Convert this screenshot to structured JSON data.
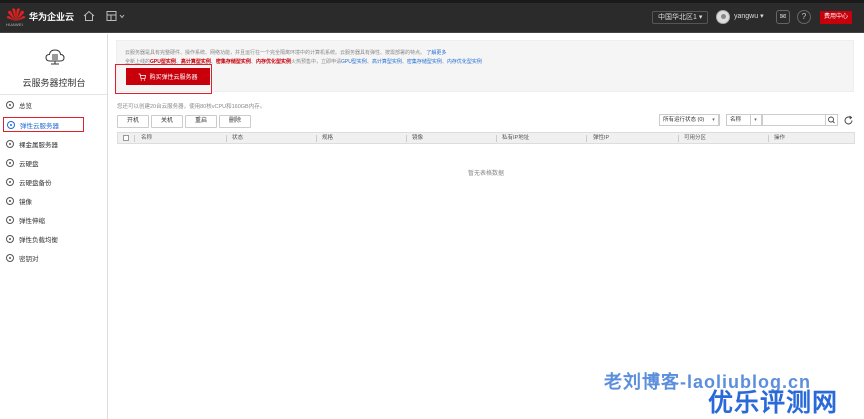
{
  "topbar": {
    "brand_name": "华为企业云",
    "logo_text": "HUAWEI",
    "region": "中国华北区1",
    "username": "yangwu",
    "billing_label": "费用中心"
  },
  "sidebar": {
    "title": "云服务器控制台",
    "items": [
      {
        "label": "总览"
      },
      {
        "label": "弹性云服务器"
      },
      {
        "label": "裸金属服务器"
      },
      {
        "label": "云硬盘"
      },
      {
        "label": "云硬盘备份"
      },
      {
        "label": "镜像"
      },
      {
        "label": "弹性伸缩"
      },
      {
        "label": "弹性负载均衡"
      },
      {
        "label": "密钥对"
      }
    ]
  },
  "notice": {
    "line1": "云服务器是具有完整硬件、操作系统、网络功能，并且运行在一个完全隔离环境中的计算机系统。云服务器具有弹性、按需部署的特点。",
    "learn_more": "了解更多",
    "line2_prefix": "全新上线的",
    "gpu": "GPU型实例",
    "hpc": "高计算型实例",
    "disk": "密集存储型实例",
    "mem": "内存优化型实例",
    "line2_mid": "火热预售中，立即申请",
    "apply_gpu": "GPU型实例",
    "apply_hpc": "高计算型实例",
    "apply_disk": "密集存储型实例",
    "apply_mem": "内存优化型实例"
  },
  "buy_button": "购买弹性云服务器",
  "quota_text": "您还可以创建20台云服务器，使用80核vCPU和160GB内存。",
  "toolbar": {
    "start": "开机",
    "stop": "关机",
    "restart": "重启",
    "delete": "删除"
  },
  "filter": {
    "status": "所有运行状态 (0)",
    "field": "名称",
    "search_placeholder": ""
  },
  "table": {
    "columns": [
      "名称",
      "状态",
      "规格",
      "镜像",
      "私有IP地址",
      "弹性IP",
      "可用分区",
      "操作"
    ],
    "empty_text": "暂无表格数据"
  },
  "watermark": {
    "line1": "老刘博客-laoliublog.cn",
    "line2": "优乐评测网"
  },
  "colors": {
    "brand_red": "#c7000b",
    "link_blue": "#1f6cd1",
    "topbar_bg": "#2b2b2b"
  }
}
